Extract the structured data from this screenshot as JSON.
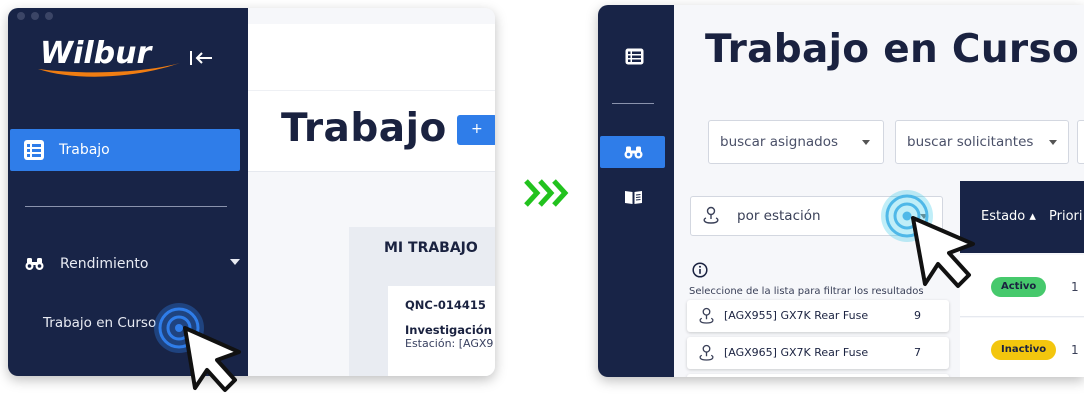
{
  "left_window": {
    "logo_text": "Wilbur",
    "sidebar": {
      "items": [
        {
          "label": "Trabajo",
          "icon": "list-icon",
          "active": true
        },
        {
          "label": "Rendimiento",
          "icon": "binoculars-icon",
          "expanded": true,
          "children": [
            "Trabajo en Curso"
          ]
        }
      ]
    },
    "page_title": "Trabajo",
    "add_button": "+",
    "section_title": "MI TRABAJO",
    "card": {
      "code": "QNC-014415",
      "name": "Investigación I",
      "station": "Estación: [AGX9"
    }
  },
  "arrow": "chevrons-right",
  "right_window": {
    "sidebar_icons": [
      "list-icon",
      "binoculars-icon",
      "book-icon"
    ],
    "page_title": "Trabajo en Curso",
    "filters": [
      {
        "placeholder": "buscar asignados"
      },
      {
        "placeholder": "buscar solicitantes"
      }
    ],
    "station_select": {
      "placeholder": "por estación"
    },
    "help_text": "Seleccione de la lista para filtrar los resultados",
    "stations": [
      {
        "label": "[AGX955] GX7K Rear Fuse",
        "count": "9"
      },
      {
        "label": "[AGX965] GX7K Rear Fuse",
        "count": "7"
      }
    ],
    "table": {
      "columns": [
        "Estado ▴",
        "Priori"
      ],
      "rows": [
        {
          "status": "Activo",
          "status_color": "#46c96c",
          "priority": "1"
        },
        {
          "status": "Inactivo",
          "status_color": "#f3c60e",
          "priority": "1"
        }
      ]
    }
  },
  "colors": {
    "sidebar": "#182447",
    "accent": "#2f7de9",
    "logo_orange": "#f07d12",
    "arrow_green": "#22c21e"
  }
}
